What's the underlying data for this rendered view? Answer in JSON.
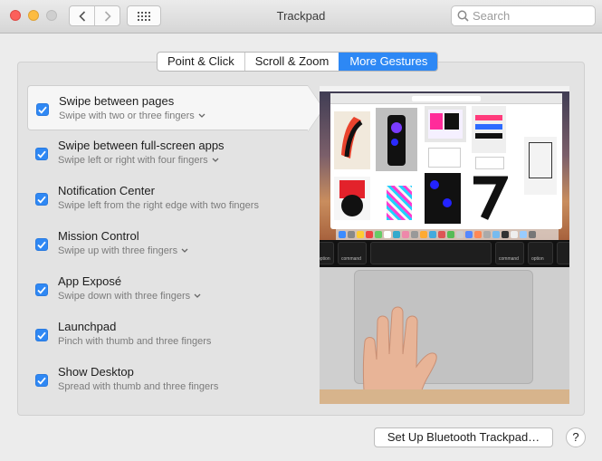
{
  "window": {
    "title": "Trackpad"
  },
  "search": {
    "placeholder": "Search"
  },
  "tabs": [
    {
      "label": "Point & Click",
      "active": false
    },
    {
      "label": "Scroll & Zoom",
      "active": false
    },
    {
      "label": "More Gestures",
      "active": true
    }
  ],
  "gestures": [
    {
      "title": "Swipe between pages",
      "subtitle": "Swipe with two or three fingers",
      "checked": true,
      "has_menu": true,
      "selected": true
    },
    {
      "title": "Swipe between full-screen apps",
      "subtitle": "Swipe left or right with four fingers",
      "checked": true,
      "has_menu": true,
      "selected": false
    },
    {
      "title": "Notification Center",
      "subtitle": "Swipe left from the right edge with two fingers",
      "checked": true,
      "has_menu": false,
      "selected": false
    },
    {
      "title": "Mission Control",
      "subtitle": "Swipe up with three fingers",
      "checked": true,
      "has_menu": true,
      "selected": false
    },
    {
      "title": "App Exposé",
      "subtitle": "Swipe down with three fingers",
      "checked": true,
      "has_menu": true,
      "selected": false
    },
    {
      "title": "Launchpad",
      "subtitle": "Pinch with thumb and three fingers",
      "checked": true,
      "has_menu": false,
      "selected": false
    },
    {
      "title": "Show Desktop",
      "subtitle": "Spread with thumb and three fingers",
      "checked": true,
      "has_menu": false,
      "selected": false
    }
  ],
  "preview": {
    "keys": {
      "option_left": "option",
      "command_left": "command",
      "command_right": "command",
      "option_right": "option"
    }
  },
  "footer": {
    "setup_label": "Set Up Bluetooth Trackpad…",
    "help_label": "?"
  },
  "colors": {
    "accent": "#2d88f5",
    "close": "#fc605b",
    "minimize": "#fdbc40"
  }
}
